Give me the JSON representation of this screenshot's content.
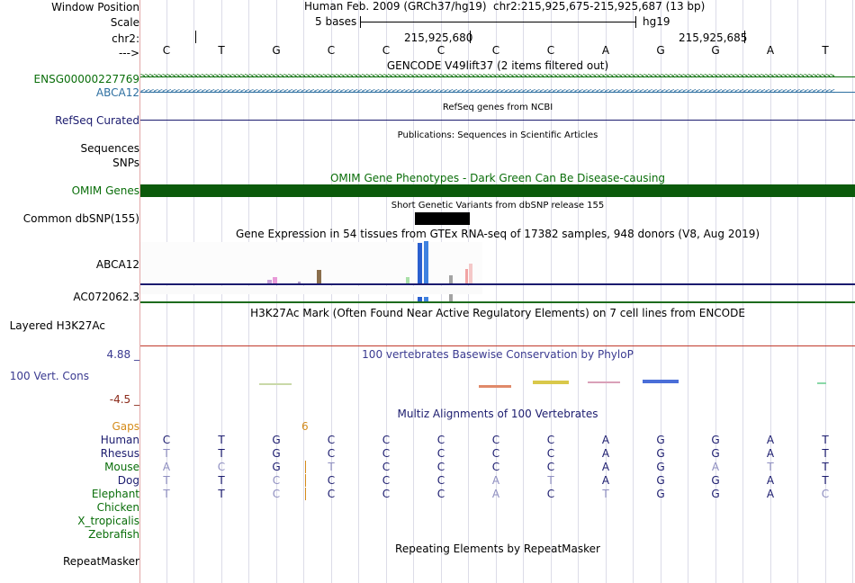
{
  "labels": {
    "window_position": "Window Position",
    "scale": "Scale",
    "chrom": "chr2:",
    "strand": "--->",
    "gene1": "ENSG00000227769",
    "gene2": "ABCA12",
    "refseq": "RefSeq Curated",
    "sequences": "Sequences",
    "snps": "SNPs",
    "omim": "OMIM Genes",
    "dbsnp": "Common dbSNP(155)",
    "gtex1": "ABCA12",
    "gtex2": "AC072062.3",
    "h3k27ac": "Layered H3K27Ac",
    "cons_top": "4.88 _",
    "cons_name": "100 Vert. Cons",
    "cons_bottom": "-4.5 _",
    "gaps": "Gaps",
    "species": [
      "Human",
      "Rhesus",
      "Mouse",
      "Dog",
      "Elephant",
      "Chicken",
      "X_tropicalis",
      "Zebrafish"
    ],
    "repeatmasker": "RepeatMasker"
  },
  "header": {
    "assembly": "Human Feb. 2009 (GRCh37/hg19)",
    "position": "chr2:215,925,675-215,925,687 (13 bp)",
    "scale_text": "5 bases",
    "db": "hg19",
    "coord1": "215,925,680",
    "coord2": "215,925,685"
  },
  "reference_bases": [
    "C",
    "T",
    "G",
    "C",
    "C",
    "C",
    "C",
    "C",
    "A",
    "G",
    "G",
    "A",
    "T"
  ],
  "tracks": {
    "gencode_title": "GENCODE V49lift37 (2 items filtered out)",
    "refseq_title": "RefSeq genes from NCBI",
    "publications_title": "Publications: Sequences in Scientific Articles",
    "omim_title": "OMIM Gene Phenotypes - Dark Green Can Be Disease-causing",
    "dbsnp_title": "Short Genetic Variants from dbSNP release 155",
    "gtex_title": "Gene Expression in 54 tissues from GTEx RNA-seq of 17382 samples, 948 donors (V8, Aug 2019)",
    "h3k27ac_title": "H3K27Ac Mark (Often Found Near Active Regulatory Elements) on 7 cell lines from ENCODE",
    "phylop_title": "100 vertebrates Basewise Conservation by PhyloP",
    "gaps_value": "6",
    "multiz_title": "Multiz Alignments of 100 Vertebrates",
    "repeatmasker_title": "Repeating Elements by RepeatMasker"
  },
  "alignments": {
    "Human": [
      "C",
      "T",
      "G",
      "C",
      "C",
      "C",
      "C",
      "C",
      "A",
      "G",
      "G",
      "A",
      "T"
    ],
    "Rhesus": [
      "T",
      "T",
      "G",
      "C",
      "C",
      "C",
      "C",
      "C",
      "A",
      "G",
      "G",
      "A",
      "T"
    ],
    "Mouse": [
      "A",
      "C",
      "G",
      "T",
      "C",
      "C",
      "C",
      "C",
      "A",
      "G",
      "A",
      "T",
      "T"
    ],
    "Dog": [
      "T",
      "T",
      "C",
      "C",
      "C",
      "C",
      "A",
      "T",
      "A",
      "G",
      "G",
      "A",
      "T"
    ],
    "Elephant": [
      "T",
      "T",
      "C",
      "C",
      "C",
      "C",
      "A",
      "C",
      "T",
      "G",
      "G",
      "A",
      "C"
    ]
  },
  "colors": {
    "gene_green": "#0a6e0a",
    "gene_blue": "#2d6fa0",
    "navy": "#1b1b6e",
    "omim": "#0b5a0b",
    "h3k27ac_line": "#c0392b",
    "phylop_text": "#3a3a90",
    "gaps": "#d48b1a",
    "species_green": "#0a6e0a",
    "dim_base": "#8e8ec0"
  }
}
